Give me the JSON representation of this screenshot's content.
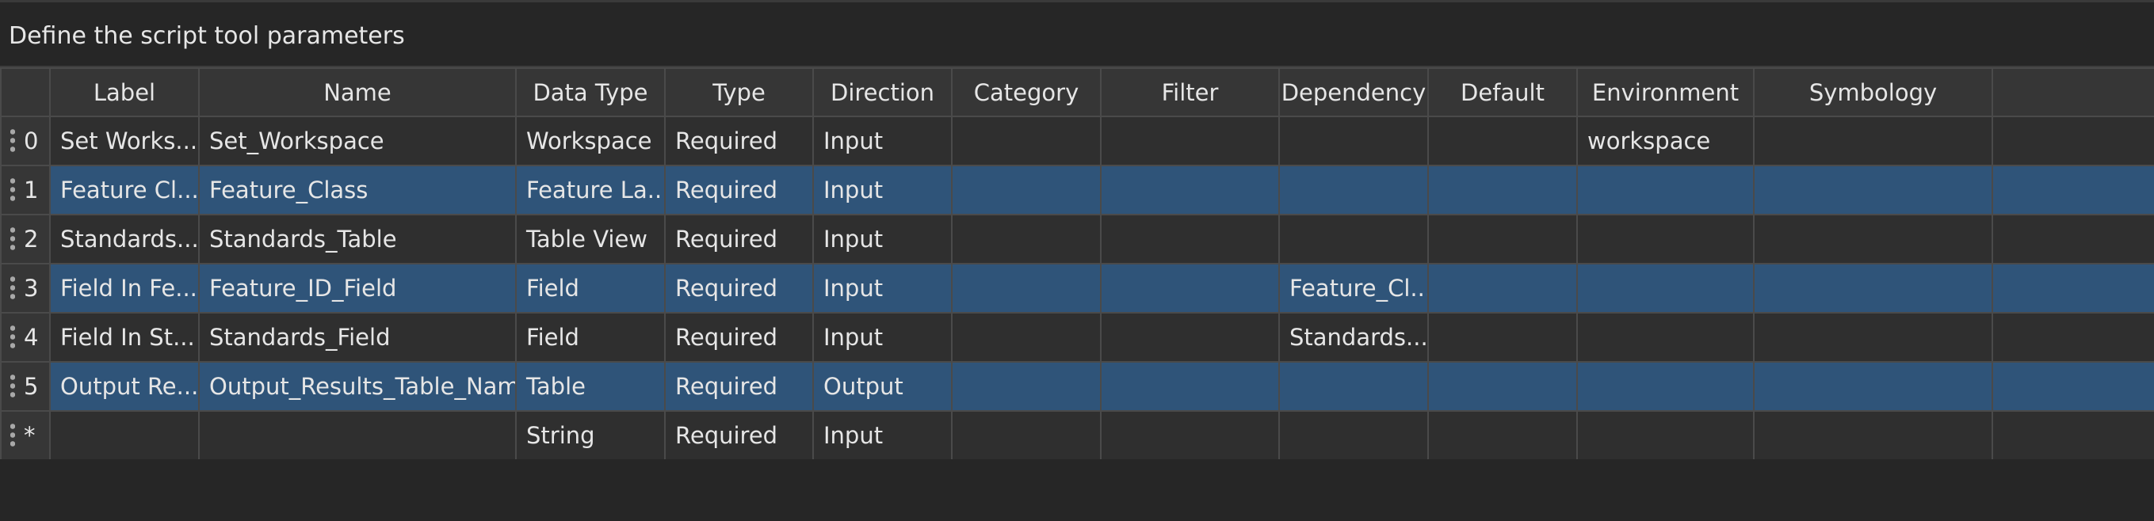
{
  "panel": {
    "title": "Define the script tool parameters"
  },
  "columns": [
    "Label",
    "Name",
    "Data Type",
    "Type",
    "Direction",
    "Category",
    "Filter",
    "Dependency",
    "Default",
    "Environment",
    "Symbology"
  ],
  "rows": [
    {
      "index": "0",
      "selected": false,
      "cells": [
        "Set Works...",
        "Set_Workspace",
        "Workspace",
        "Required",
        "Input",
        "",
        "",
        "",
        "",
        "workspace",
        ""
      ]
    },
    {
      "index": "1",
      "selected": true,
      "cells": [
        "Feature Cl...",
        "Feature_Class",
        "Feature La...",
        "Required",
        "Input",
        "",
        "",
        "",
        "",
        "",
        ""
      ]
    },
    {
      "index": "2",
      "selected": false,
      "cells": [
        "Standards...",
        "Standards_Table",
        "Table View",
        "Required",
        "Input",
        "",
        "",
        "",
        "",
        "",
        ""
      ]
    },
    {
      "index": "3",
      "selected": true,
      "cells": [
        "Field In Fe...",
        "Feature_ID_Field",
        "Field",
        "Required",
        "Input",
        "",
        "",
        "Feature_Cl...",
        "",
        "",
        ""
      ]
    },
    {
      "index": "4",
      "selected": false,
      "cells": [
        "Field In St...",
        "Standards_Field",
        "Field",
        "Required",
        "Input",
        "",
        "",
        "Standards...",
        "",
        "",
        ""
      ]
    },
    {
      "index": "5",
      "selected": true,
      "cells": [
        "Output Re...",
        "Output_Results_Table_Name",
        "Table",
        "Required",
        "Output",
        "",
        "",
        "",
        "",
        "",
        ""
      ]
    },
    {
      "index": "*",
      "selected": false,
      "cells": [
        "",
        "",
        "String",
        "Required",
        "Input",
        "",
        "",
        "",
        "",
        "",
        ""
      ]
    }
  ],
  "icons": {
    "row_handle": "drag-grip-icon"
  },
  "colors": {
    "background": "#262626",
    "header": "#363636",
    "row": "#2f2f2f",
    "selected_row": "#2f5479",
    "grid_line": "#4a4a4a",
    "text": "#e6e6e6"
  }
}
